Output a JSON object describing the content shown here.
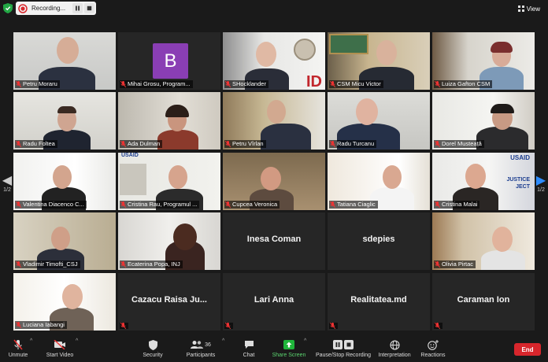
{
  "topbar": {
    "recording_label": "Recording...",
    "view_label": "View"
  },
  "nav": {
    "page_left": "1/2",
    "page_right": "1/2"
  },
  "participants": [
    {
      "name": "Petru Moraru",
      "kind": "video",
      "muted": true
    },
    {
      "name": "Mihai Grosu, Program...",
      "kind": "avatar",
      "avatar_letter": "B",
      "muted": true
    },
    {
      "name": "SHocklander",
      "kind": "video",
      "muted": true
    },
    {
      "name": "CSM Micu Victor",
      "kind": "video",
      "muted": true
    },
    {
      "name": "Luiza Gafton CSM",
      "kind": "video",
      "muted": true
    },
    {
      "name": "Radu Foltea",
      "kind": "video",
      "muted": true
    },
    {
      "name": "Ada Dulman",
      "kind": "video",
      "muted": true
    },
    {
      "name": "Petru Vîrlan",
      "kind": "video",
      "muted": true
    },
    {
      "name": "Radu Turcanu",
      "kind": "video",
      "muted": true
    },
    {
      "name": "Dorel Musteață",
      "kind": "video",
      "muted": true
    },
    {
      "name": "Valentina Diacenco C...",
      "kind": "video",
      "muted": true
    },
    {
      "name": "Cristina Rau, Programul ...",
      "kind": "video",
      "muted": true
    },
    {
      "name": "Cupcea Veronica",
      "kind": "video",
      "muted": true
    },
    {
      "name": "Tatiana Ciaglic",
      "kind": "video",
      "muted": true
    },
    {
      "name": "Cristina Malai",
      "kind": "video",
      "muted": true
    },
    {
      "name": "Vladimir Timofti_CSJ",
      "kind": "video",
      "muted": true
    },
    {
      "name": "Ecaterina Popa, INJ",
      "kind": "video",
      "muted": true
    },
    {
      "name": "Inesa Coman",
      "kind": "name",
      "muted": false
    },
    {
      "name": "sdepies",
      "kind": "name",
      "muted": false
    },
    {
      "name": "Olivia Pirtac",
      "kind": "video",
      "muted": true
    },
    {
      "name": "Luciana Iabangi",
      "kind": "video",
      "muted": true
    },
    {
      "name": "Cazacu  Raisa  Ju...",
      "kind": "name",
      "muted": true
    },
    {
      "name": "Lari Anna",
      "kind": "name",
      "muted": true
    },
    {
      "name": "Realitatea.md",
      "kind": "name",
      "muted": true
    },
    {
      "name": "Caraman Ion",
      "kind": "name",
      "muted": true
    }
  ],
  "toolbar": {
    "unmute": "Unmute",
    "start_video": "Start Video",
    "security": "Security",
    "participants": "Participants",
    "participants_count": "36",
    "chat": "Chat",
    "share_screen": "Share Screen",
    "pause_recording": "Pause/Stop Recording",
    "interpretation": "Interpretation",
    "reactions": "Reactions",
    "end": "End"
  },
  "colors": {
    "end_button": "#d8262c",
    "share_green": "#1fb53a",
    "avatar_purple": "#8a3eb4",
    "background": "#1a1a1a"
  }
}
